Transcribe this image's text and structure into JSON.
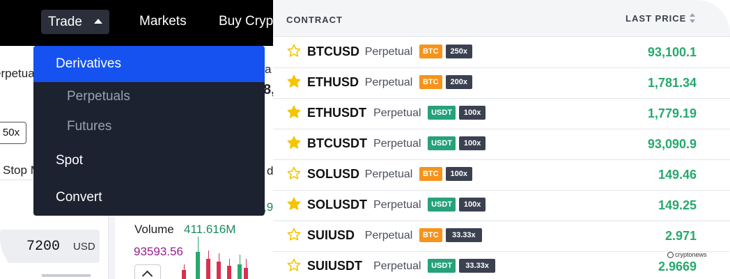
{
  "topnav": {
    "trade_label": "Trade",
    "markets_label": "Markets",
    "buy_crypto_label": "Buy Cryp"
  },
  "dropdown": {
    "items": [
      {
        "label": "Derivatives"
      },
      {
        "label": "Perpetuals"
      },
      {
        "label": "Futures"
      },
      {
        "label": "Spot"
      },
      {
        "label": "Convert"
      }
    ]
  },
  "order_panel": {
    "perpetual_fragment": "erpetua",
    "leverage_box": "50x",
    "stop_tab_fragment": "Stop M",
    "price_value": "7200",
    "price_unit": "USD"
  },
  "chart_panel": {
    "frag_a": "a",
    "frag_b": "8,",
    "frag_c": "d",
    "frag_d": ",9",
    "volume_label": "Volume",
    "volume_value": "411.616M",
    "price_marker": "93593.56"
  },
  "contracts": {
    "header_contract": "CONTRACT",
    "header_last_price": "LAST PRICE",
    "rows": [
      {
        "symbol": "BTCUSD",
        "type": "Perpetual",
        "settle": "BTC",
        "leverage": "250x",
        "price": "93,100.1",
        "favorite": false
      },
      {
        "symbol": "ETHUSD",
        "type": "Perpetual",
        "settle": "BTC",
        "leverage": "200x",
        "price": "1,781.34",
        "favorite": true
      },
      {
        "symbol": "ETHUSDT",
        "type": "Perpetual",
        "settle": "USDT",
        "leverage": "100x",
        "price": "1,779.19",
        "favorite": true
      },
      {
        "symbol": "BTCUSDT",
        "type": "Perpetual",
        "settle": "USDT",
        "leverage": "100x",
        "price": "93,090.9",
        "favorite": true
      },
      {
        "symbol": "SOLUSD",
        "type": "Perpetual",
        "settle": "BTC",
        "leverage": "100x",
        "price": "149.46",
        "favorite": false
      },
      {
        "symbol": "SOLUSDT",
        "type": "Perpetual",
        "settle": "USDT",
        "leverage": "100x",
        "price": "149.25",
        "favorite": true
      },
      {
        "symbol": "SUIUSD",
        "type": "Perpetual",
        "settle": "BTC",
        "leverage": "33.33x",
        "price": "2.971",
        "favorite": false
      },
      {
        "symbol": "SUIUSDT",
        "type": "Perpetual",
        "settle": "USDT",
        "leverage": "33.33x",
        "price": "2.9669",
        "favorite": false
      }
    ]
  },
  "colors": {
    "price_up": "#26a96c",
    "btc_tag": "#f7931a",
    "usdt_tag": "#26a17b",
    "active_menu": "#1552f0",
    "star_filled": "#f5c400"
  },
  "icons": {
    "favorite": "star-icon",
    "sort": "sort-arrows-icon",
    "nav_caret": "caret-up-icon"
  },
  "watermark": "cryptonews"
}
